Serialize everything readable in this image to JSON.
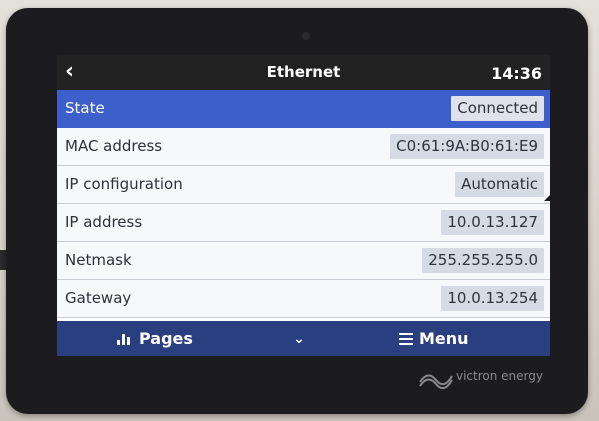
{
  "header": {
    "title": "Ethernet",
    "time": "14:36",
    "back_icon": "chevron-left-icon"
  },
  "rows": [
    {
      "label": "State",
      "value": "Connected",
      "selected": true
    },
    {
      "label": "MAC address",
      "value": "C0:61:9A:B0:61:E9"
    },
    {
      "label": "IP configuration",
      "value": "Automatic",
      "has_dropdown": true
    },
    {
      "label": "IP address",
      "value": "10.0.13.127"
    },
    {
      "label": "Netmask",
      "value": "255.255.255.0"
    },
    {
      "label": "Gateway",
      "value": "10.0.13.254"
    }
  ],
  "footer": {
    "pages_label": "Pages",
    "menu_label": "Menu",
    "pages_icon": "bar-chart-icon",
    "middle_icon": "chevron-down-icon",
    "menu_icon": "hamburger-icon"
  },
  "brand": {
    "name": "victron energy"
  },
  "colors": {
    "header_bg": "#222222",
    "selected_row": "#3d5fcb",
    "footer_bg": "#2a3f80",
    "value_chip": "#d6dae4"
  }
}
